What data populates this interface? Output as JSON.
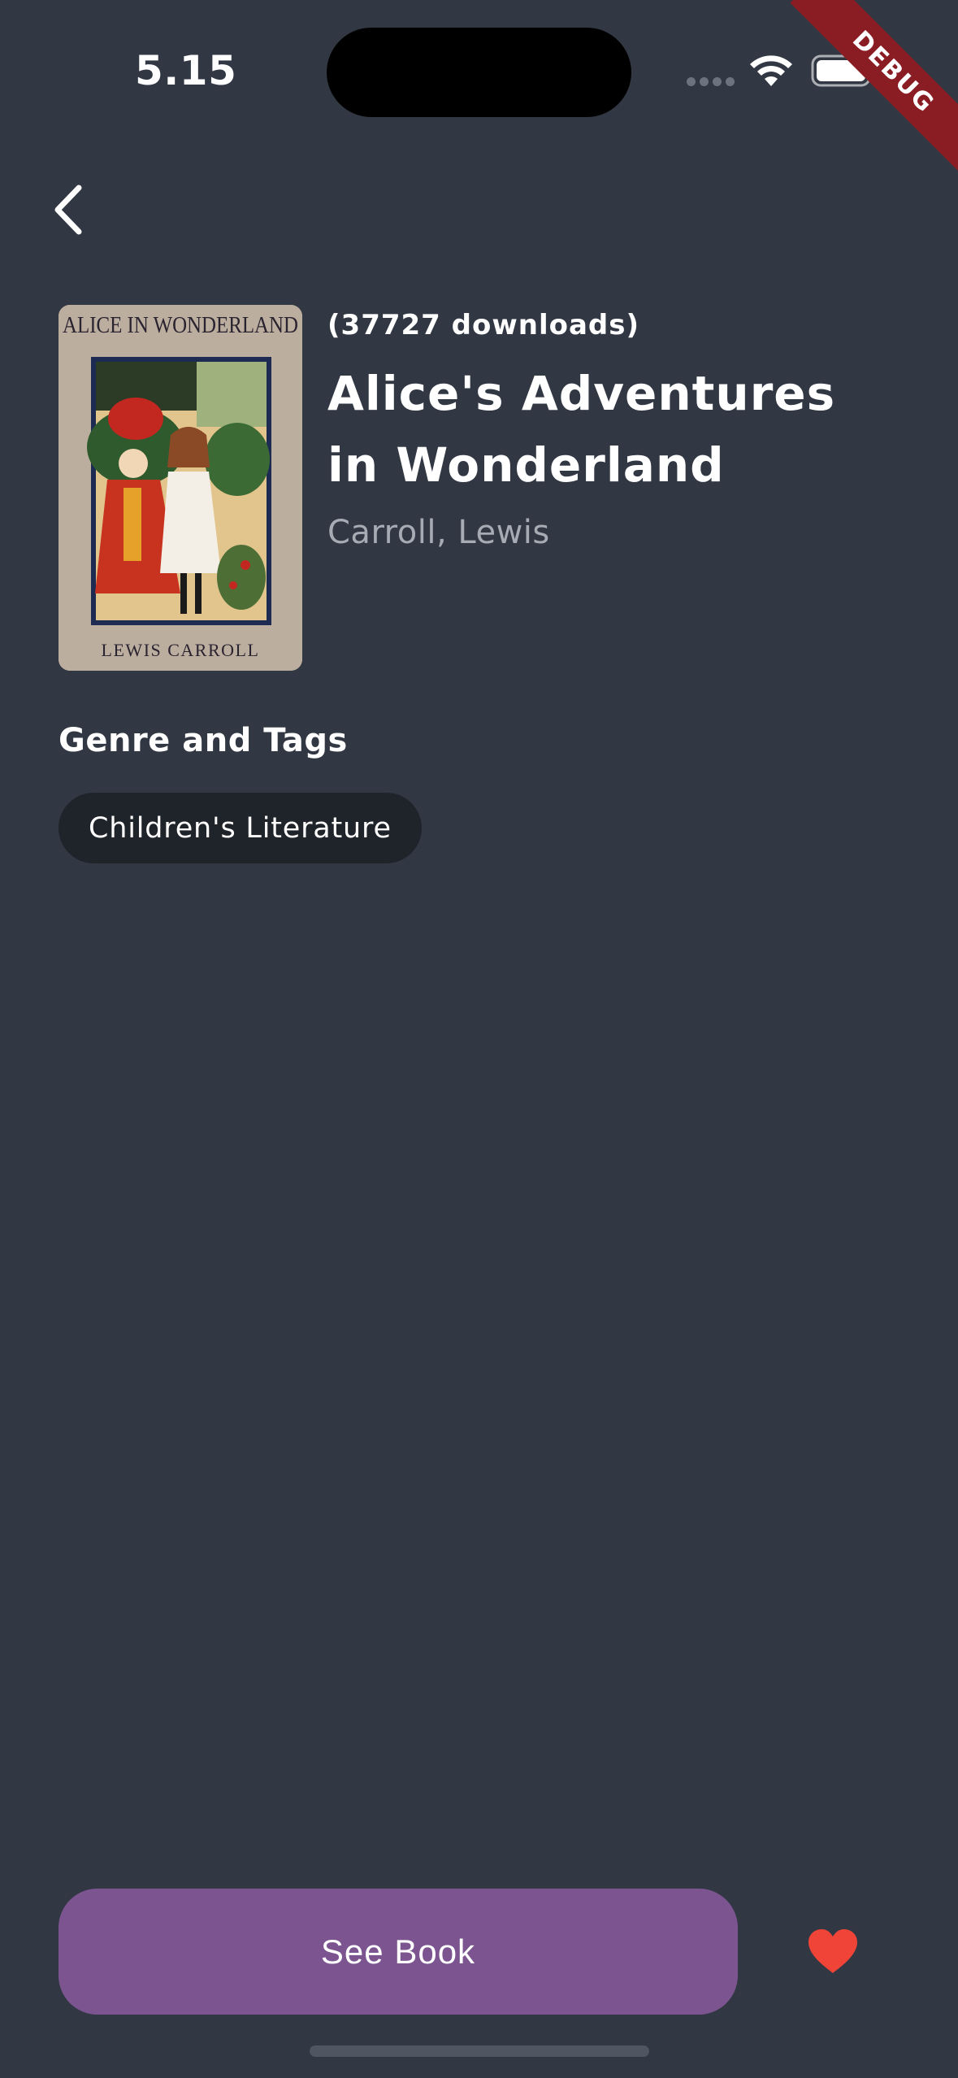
{
  "status_bar": {
    "time": "5.15",
    "debug_label": "DEBUG"
  },
  "nav": {
    "back_icon": "chevron-left-icon"
  },
  "book": {
    "downloads": "(37727 downloads)",
    "title": "Alice's Adventures in Wonderland",
    "author": "Carroll, Lewis",
    "cover": {
      "top_text": "ALICE IN WONDERLAND",
      "bottom_text": "LEWIS CARROLL"
    }
  },
  "genre_section": {
    "heading": "Genre and Tags",
    "tags": [
      "Children's Literature"
    ]
  },
  "actions": {
    "see_book_label": "See Book",
    "favorite_icon": "heart-icon",
    "favorite_color": "#f04438"
  },
  "colors": {
    "background": "#313743",
    "accent_button": "#7c5590",
    "chip_background": "#1f232a",
    "muted_text": "#a6abb4"
  }
}
